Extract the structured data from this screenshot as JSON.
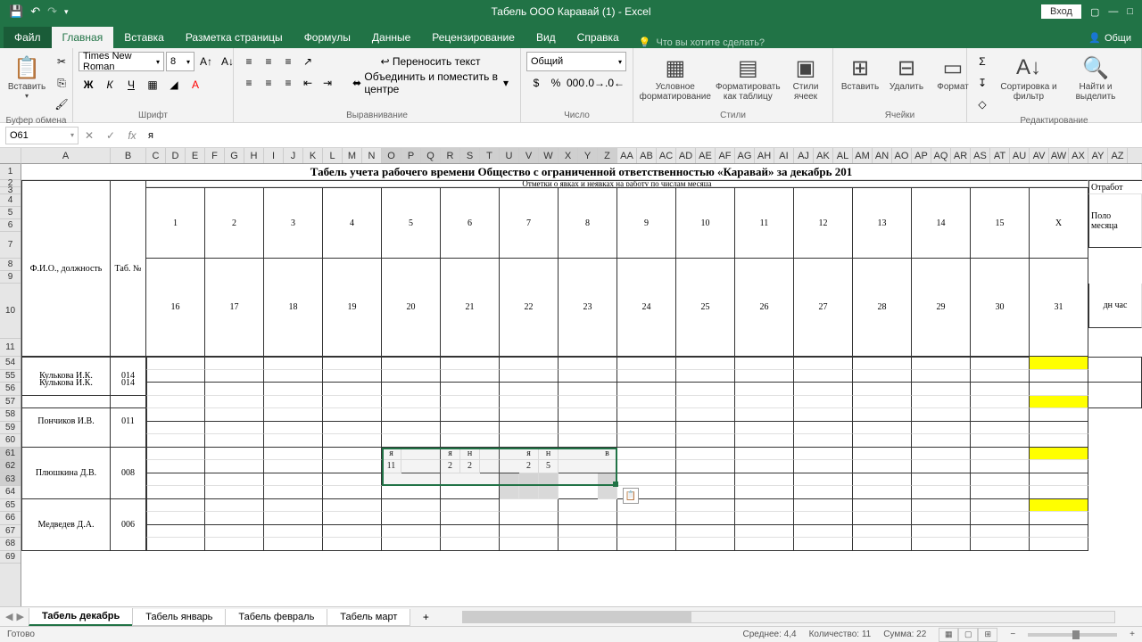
{
  "titlebar": {
    "title": "Табель ООО Каравай (1) - Excel",
    "signin": "Вход"
  },
  "tabs": {
    "file": "Файл",
    "home": "Главная",
    "insert": "Вставка",
    "layout": "Разметка страницы",
    "formulas": "Формулы",
    "data": "Данные",
    "review": "Рецензирование",
    "view": "Вид",
    "help": "Справка",
    "tell": "Что вы хотите сделать?",
    "share": "Общи"
  },
  "ribbon": {
    "clipboard": {
      "label": "Буфер обмена",
      "paste": "Вставить"
    },
    "font": {
      "label": "Шрифт",
      "name": "Times New Roman",
      "size": "8"
    },
    "alignment": {
      "label": "Выравнивание",
      "wrap": "Переносить текст",
      "merge": "Объединить и поместить в центре"
    },
    "number": {
      "label": "Число",
      "format": "Общий"
    },
    "styles": {
      "label": "Стили",
      "cond": "Условное форматирование",
      "table": "Форматировать как таблицу",
      "cell": "Стили ячеек"
    },
    "cells": {
      "label": "Ячейки",
      "insert": "Вставить",
      "delete": "Удалить",
      "format": "Формат"
    },
    "editing": {
      "label": "Редактирование",
      "sort": "Сортировка и фильтр",
      "find": "Найти и выделить"
    }
  },
  "formula": {
    "namebox": "O61",
    "value": "я"
  },
  "columns": [
    "A",
    "B",
    "C",
    "D",
    "E",
    "F",
    "G",
    "H",
    "I",
    "J",
    "K",
    "L",
    "M",
    "N",
    "O",
    "P",
    "Q",
    "R",
    "S",
    "T",
    "U",
    "V",
    "W",
    "X",
    "Y",
    "Z",
    "AA",
    "AB",
    "AC",
    "AD",
    "AE",
    "AF",
    "AG",
    "AH",
    "AI",
    "AJ",
    "AK",
    "AL",
    "AM",
    "AN",
    "AO",
    "AP",
    "AQ",
    "AR",
    "AS",
    "AT",
    "AU",
    "AV",
    "AW",
    "AX",
    "AY",
    "AZ"
  ],
  "col_widths": {
    "A": 100,
    "B": 40,
    "def": 22,
    "day": 66
  },
  "rows_top": [
    "1",
    "2",
    "3",
    "4",
    "5",
    "6",
    "7",
    "8",
    "9",
    "10",
    "11"
  ],
  "rows_bot": [
    "54",
    "55",
    "56",
    "57",
    "58",
    "59",
    "60",
    "61",
    "62",
    "63",
    "64",
    "65",
    "66",
    "67",
    "68",
    "69"
  ],
  "sheet": {
    "title": "Табель учета рабочего времени Общество с ограниченной ответственностью «Каравай» за декабрь 201",
    "marks": "Отметки о явках и неявках на работу по числам месяца",
    "fio": "Ф.И.О., должность",
    "tabno": "Таб. №",
    "halfmonth": "Поло месяца",
    "hrs": "дн час",
    "otrab": "Отработ",
    "days": [
      "1",
      "2",
      "3",
      "4",
      "5",
      "6",
      "7",
      "8",
      "9",
      "10",
      "11",
      "12",
      "13",
      "14",
      "15",
      "X"
    ],
    "days2": [
      "16",
      "17",
      "18",
      "19",
      "20",
      "21",
      "22",
      "23",
      "24",
      "25",
      "26",
      "27",
      "28",
      "29",
      "30",
      "31"
    ],
    "emp": [
      {
        "name": "Кулькова И.К.",
        "no": "014"
      },
      {
        "name": "Пончиков И.В.",
        "no": "011"
      },
      {
        "name": "Плюшкина Д.В.",
        "no": "008"
      },
      {
        "name": "Медведев Д.А.",
        "no": "006"
      }
    ],
    "entry": {
      "r1": [
        "я",
        "",
        "",
        "я",
        "н",
        "",
        "",
        "я",
        "н",
        "",
        "",
        "в"
      ],
      "r2": [
        "11",
        "",
        "",
        "2",
        "2",
        "",
        "",
        "2",
        "5",
        "",
        "",
        ""
      ]
    }
  },
  "sheets": [
    "Табель декабрь",
    "Табель январь",
    "Табель февраль",
    "Табель март"
  ],
  "status": {
    "ready": "Готово",
    "avg": "Среднее: 4,4",
    "count": "Количество: 11",
    "sum": "Сумма: 22"
  }
}
